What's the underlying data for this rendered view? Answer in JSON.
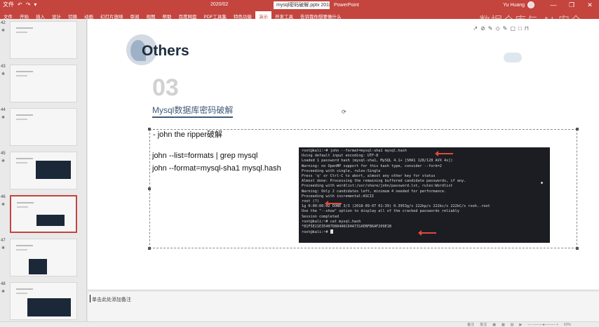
{
  "ribbon": {
    "quick_access": [
      "文件",
      "↶",
      "↷",
      "▾"
    ],
    "pre_title": "2020/02",
    "document_title": "mysql密码破解.pptx 2018 12",
    "app_name": "PowerPoint",
    "user_name": "Yu Huang",
    "window_controls": [
      "—",
      "❐",
      "✕"
    ],
    "tabs": [
      "文件",
      "开始",
      "插入",
      "设计",
      "切换",
      "动画",
      "幻灯片放映",
      "审阅",
      "视图",
      "帮助",
      "百度网盘",
      "PDF工具集",
      "特色功能",
      "演示",
      "开发工具",
      "告诉我你想要做什么"
    ],
    "active_tab": 13,
    "accent": "#c4443e"
  },
  "thumbnails": [
    {
      "number": "42",
      "star": "✱"
    },
    {
      "number": "43",
      "star": "✱"
    },
    {
      "number": "44",
      "star": "✱"
    },
    {
      "number": "45",
      "star": "✱"
    },
    {
      "number": "46",
      "star": "✱"
    },
    {
      "number": "47",
      "star": "✱"
    },
    {
      "number": "48",
      "star": "✱"
    }
  ],
  "selected_thumbnail": 4,
  "slide": {
    "heading": "Others",
    "section_number": "03",
    "section_title": "Mysql数据库密码破解",
    "bullet": "- john the ripper破解",
    "commands": [
      "john --list=formats | grep mysql",
      "john --format=mysql-sha1 mysql.hash"
    ],
    "rotate_glyph": "⟳",
    "toolbar_glyphs": [
      "↗",
      "⊘",
      "✎",
      "◇",
      "✎",
      "▢",
      "□",
      "⊓"
    ]
  },
  "terminal": {
    "lines": [
      "root@kali:~# john --format=mysql-sha1 mysql.hash",
      "Using default input encoding: UTF-8",
      "Loaded 1 password hash (mysql-sha1, MySQL 4.1+ [SHA1 128/128 AVX 4x])",
      "Warning: no OpenMP support for this hash type, consider --fork=2",
      "Proceeding with single, rules:Single",
      "Press 'q' or Ctrl-C to abort, almost any other key for status",
      "Almost done: Processing the remaining buffered candidate passwords, if any.",
      "Proceeding with wordlist:/usr/share/john/password.lst, rules:Wordlist",
      "Warning: Only 2 candidates left, minimum 4 needed for performance.",
      "Proceeding with incremental:ASCII",
      "root             (?)",
      "1g 0:00:00:02 DONE 3/3 (2018-09-07 01:39) 0.3953g/s 222kp/s 222kc/s 222kC/s rooh..root",
      "Use the \"--show\" option to display all of the cracked passwords reliably",
      "Session completed",
      "root@kali:~# cat mysql.hash",
      "*81F5E21E35407D884A6CD4A731AEBFB6AF209E1B",
      "root@kali:~# "
    ]
  },
  "notes": {
    "text": "单击此处添加备注"
  },
  "status": {
    "items": [
      "备注",
      "批注",
      "▣",
      "▦",
      "▤",
      "▶",
      "— ———●——— +",
      "62%"
    ]
  },
  "watermark": "数据仓库与 AI 安全"
}
